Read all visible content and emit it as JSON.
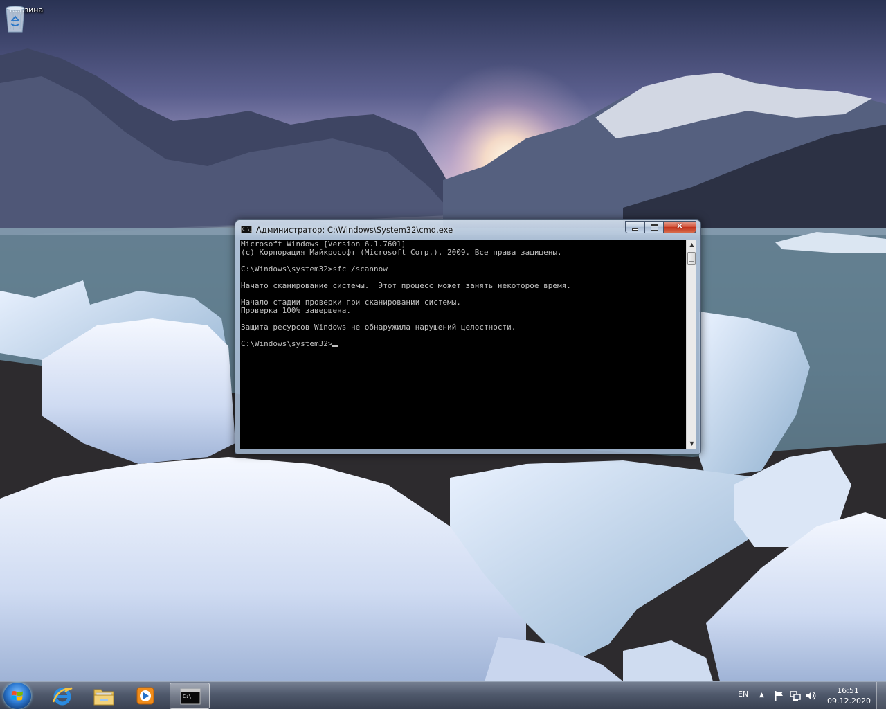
{
  "desktop": {
    "icons": [
      {
        "label": "Корзина",
        "icon": "recycle-bin-icon"
      }
    ]
  },
  "cmd_window": {
    "title": "Администратор: C:\\Windows\\System32\\cmd.exe",
    "icon": "cmd-icon",
    "controls": {
      "minimize": "minimize-icon",
      "maximize": "maximize-icon",
      "close": "✕"
    },
    "console_lines": [
      "Microsoft Windows [Version 6.1.7601]",
      "(c) Корпорация Майкрософт (Microsoft Corp.), 2009. Все права защищены.",
      "",
      "C:\\Windows\\system32>sfc /scannow",
      "",
      "Начато сканирование системы.  Этот процесс может занять некоторое время.",
      "",
      "Начало стадии проверки при сканировании системы.",
      "Проверка 100% завершена.",
      "",
      "Защита ресурсов Windows не обнаружила нарушений целостности.",
      "",
      "C:\\Windows\\system32>"
    ],
    "scrollbar": {
      "up": "▲",
      "down": "▼"
    }
  },
  "taskbar": {
    "start_icon": "windows-logo-icon",
    "pinned": [
      {
        "name": "internet-explorer",
        "icon": "internet-explorer-icon"
      },
      {
        "name": "windows-explorer",
        "icon": "folder-icon"
      },
      {
        "name": "media-player",
        "icon": "media-player-icon"
      },
      {
        "name": "cmd",
        "icon": "cmd-icon",
        "active": true
      }
    ],
    "tray": {
      "language": "EN",
      "show_hidden": "▲",
      "icons": [
        "action-center-flag-icon",
        "network-icon",
        "volume-icon"
      ]
    },
    "clock": {
      "time": "16:51",
      "date": "09.12.2020"
    }
  }
}
